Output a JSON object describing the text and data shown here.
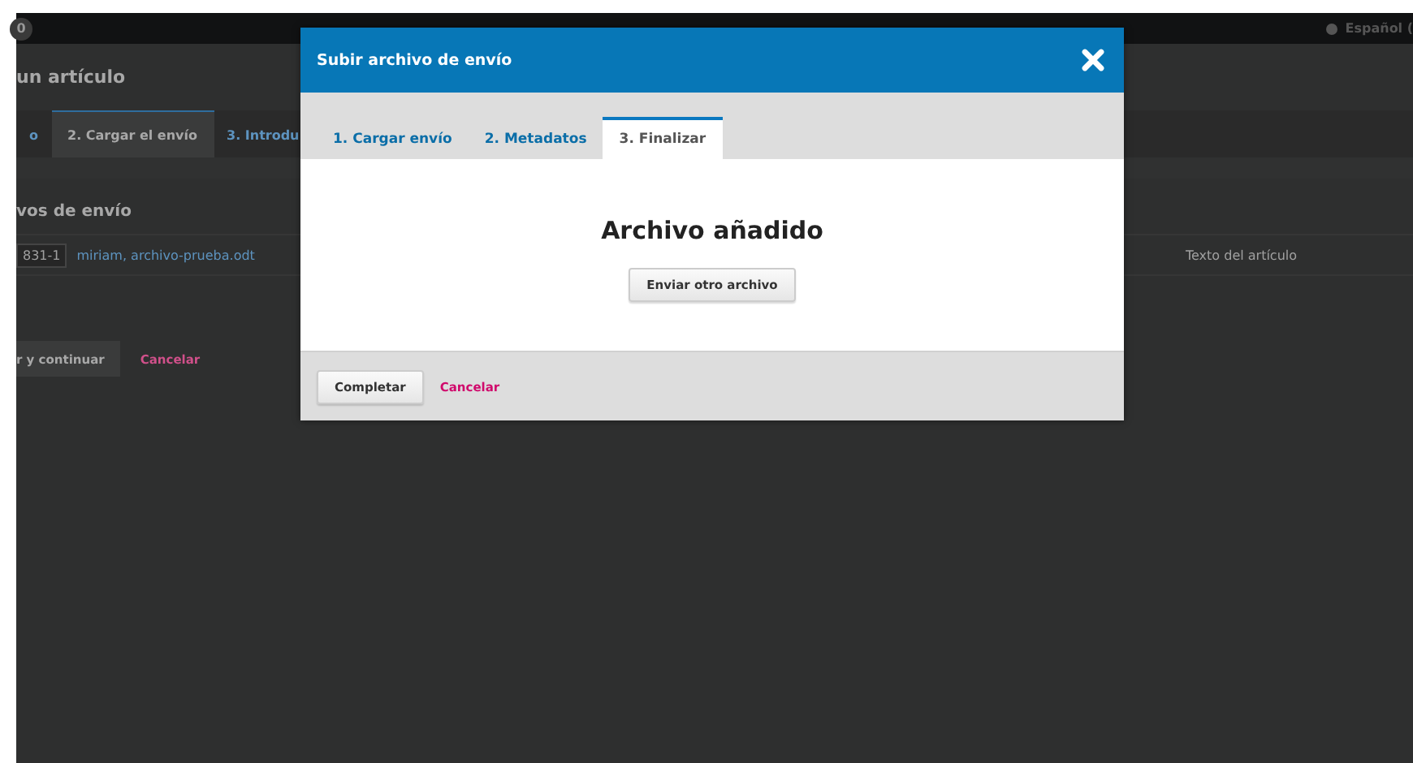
{
  "top_bar": {
    "badge": "0",
    "language": "Español ("
  },
  "page": {
    "title": "un artículo",
    "tabs": [
      {
        "label": "o",
        "selected": false
      },
      {
        "label": "2. Cargar el envío",
        "selected": true
      },
      {
        "label": "3. Introdu",
        "selected": false
      }
    ],
    "files_heading": "vos de envío",
    "files": [
      {
        "id": "831-1",
        "name": "miriam, archivo-prueba.odt",
        "type": "Texto del artículo"
      }
    ],
    "continue_button": "r y continuar",
    "cancel_link": "Cancelar"
  },
  "modal": {
    "title": "Subir archivo de envío",
    "tabs": [
      {
        "label": "1. Cargar envío",
        "selected": false
      },
      {
        "label": "2. Metadatos",
        "selected": false
      },
      {
        "label": "3. Finalizar",
        "selected": true
      }
    ],
    "heading": "Archivo añadido",
    "upload_another_button": "Enviar otro archivo",
    "complete_button": "Completar",
    "cancel_link": "Cancelar"
  }
}
